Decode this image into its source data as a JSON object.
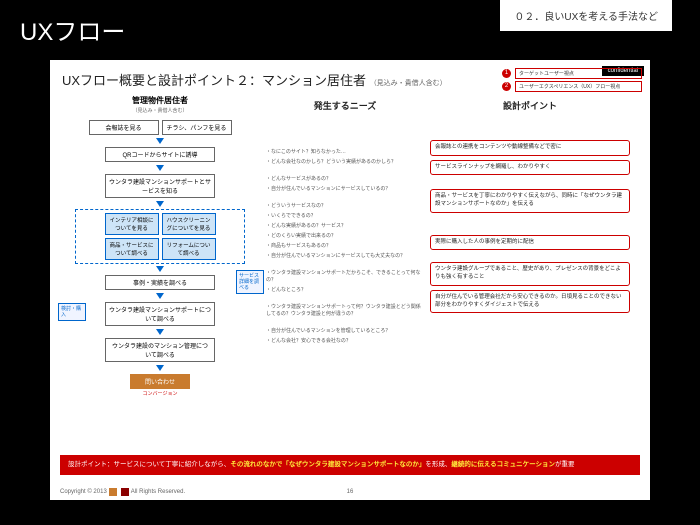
{
  "header": {
    "title": "UXフロー",
    "tag": "０２．良いUXを考える手法など"
  },
  "slide": {
    "confidential": "confidential",
    "title": "UXフロー概要と設計ポイント２：マンション居住者",
    "title_sub": "（見込み・貴借人含む）",
    "legend": [
      {
        "n": "1",
        "text": "ターゲットユーザー視点"
      },
      {
        "n": "2",
        "text": "ユーザーエクスペリエンス（UX）フロー視点"
      }
    ],
    "columns": {
      "flow_head": "管理物件居住者",
      "flow_sub": "（見込み・貴借人含む）",
      "needs_head": "発生するニーズ",
      "points_head": "設計ポイント"
    },
    "flow": {
      "r1a": "会報誌を見る",
      "r1b": "チラシ、パンフを見る",
      "r2": "QRコードからサイトに誘導",
      "r3": "ウンタラ建設マンションサポートとサービスを知る",
      "b1": "インテリア相談についてを見る",
      "b2": "ハウスクリーニングについてを見る",
      "b3": "商品・サービスについて調べる",
      "b4": "リフォームについて調べる",
      "side_l": "検討・購入",
      "side_r": "サービス詳細を調べる",
      "r5": "事例・実績を調べる",
      "r6": "ウンタラ建設マンションサポートについて調べる",
      "r7": "ウンタラ建設のマンション管理について調べる",
      "term": "問い合わせ",
      "term_sub": "コンバージョン"
    },
    "needs": [
      "なにこのサイト？知らなかった…",
      "どんな会社なのかしら？どういう実績があるのかしら？",
      "どんなサービスがあるの？",
      "自分が住んでいるマンションにサービスしているの？",
      "どういうサービスなの？",
      "いくらでできるの？",
      "どんな実績があるの？サービス？",
      "どのくらい実績で出来るの？",
      "商品もサービスもあるの？",
      "自分が住んでいるマンションにサービスしても大丈夫なの？",
      "ウンタラ建設マンションサポートだからこそ、できることって何なの？",
      "どんなところ？",
      "ウンタラ建設マンションサポートって何？ウンタラ建設とどう関係してるの？ウンタラ建設と何が違うの？",
      "自分が住んでいるマンションを管理しているところ？",
      "どんな会社？安心できる会社なの？"
    ],
    "points": [
      "会報誌との連携をコンテンツや動線整備などで密に",
      "サービスラインナップを網羅し、わかりやすく",
      "商品・サービスを丁寧にわかりやすく伝えながら、同時に「なぜウンタラ建設マンションサポートなのか」を伝える",
      "実際に購入した人の事例を定期的に配信",
      "ウンタラ建設グループであること、歴史があり、プレゼンスの背景をどこよりも強く有すること",
      "自分が住んでいる管理会社だから安心できるのか。日頃見ることのできない部分をわかりやすくダイジェストで伝える"
    ],
    "summary": {
      "pre": "設計ポイント：サービスについて丁寧に紹介しながら、",
      "em1": "その流れのなかで「なぜウンタラ建設マンションサポートなのか」",
      "mid": "を形成、",
      "em2": "継続的に伝えるコミュニケーション",
      "post": "が重要"
    },
    "footer": {
      "copyright": "Copyright © 2013",
      "rights": "All Rights Reserved.",
      "page": "16"
    }
  }
}
